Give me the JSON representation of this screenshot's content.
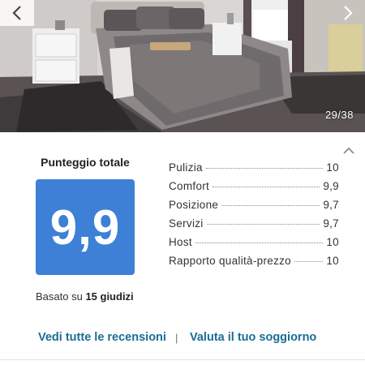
{
  "gallery": {
    "counter": "29/38",
    "prev_icon": "chevron-left-icon",
    "next_icon": "chevron-right-icon"
  },
  "collapse_icon": "chevron-up-icon",
  "score": {
    "title": "Punteggio totale",
    "value": "9,9",
    "box_color": "#3d80d6",
    "based_on_prefix": "Basato su ",
    "based_on_count": "15 giudizi"
  },
  "ratings": [
    {
      "label": "Pulizia",
      "value": "10"
    },
    {
      "label": "Comfort",
      "value": "9,9"
    },
    {
      "label": "Posizione",
      "value": "9,7"
    },
    {
      "label": "Servizi",
      "value": "9,7"
    },
    {
      "label": "Host",
      "value": "10"
    },
    {
      "label": "Rapporto qualità-prezzo",
      "value": "10"
    }
  ],
  "links": {
    "all_reviews": "Vedi tutte le recensioni",
    "separator": "|",
    "rate_stay": "Valuta il tuo soggiorno",
    "link_color": "#1a6d96"
  }
}
